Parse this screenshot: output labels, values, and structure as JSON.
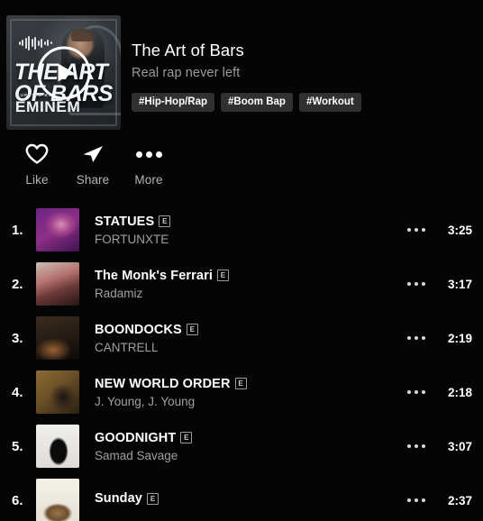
{
  "album": {
    "title": "The Art of Bars",
    "subtitle": "Real rap never left",
    "artwork": {
      "line1": "THE ART",
      "line2": "OF BARS",
      "credit_small": "CURATED BY",
      "credit_large": "EMINEM"
    },
    "tags": [
      "#Hip-Hop/Rap",
      "#Boom Bap",
      "#Workout"
    ]
  },
  "actions": [
    {
      "label": "Like",
      "icon": "heart-icon"
    },
    {
      "label": "Share",
      "icon": "paper-plane-icon"
    },
    {
      "label": "More",
      "icon": "ellipsis-icon"
    }
  ],
  "tracks": [
    {
      "index": "1.",
      "name": "STATUES",
      "explicit": "E",
      "artist": "FORTUNXTE",
      "duration": "3:25",
      "art_color": "#7a2f8c",
      "art_color2": "#c05a9a"
    },
    {
      "index": "2.",
      "name": "The Monk's Ferrari",
      "explicit": "E",
      "artist": "Radamiz",
      "duration": "3:17",
      "art_color": "#8d6a66",
      "art_color2": "#c5a79f"
    },
    {
      "index": "3.",
      "name": "BOONDOCKS",
      "explicit": "E",
      "artist": "CANTRELL",
      "duration": "2:19",
      "art_color": "#4a3524",
      "art_color2": "#8a5f38"
    },
    {
      "index": "4.",
      "name": "NEW WORLD ORDER",
      "explicit": "E",
      "artist": "J. Young, J. Young",
      "duration": "2:18",
      "art_color": "#6b4f2c",
      "art_color2": "#a8833f"
    },
    {
      "index": "5.",
      "name": "GOODNIGHT",
      "explicit": "E",
      "artist": "Samad Savage",
      "duration": "3:07",
      "art_color": "#e8e8e6",
      "art_color2": "#111111"
    },
    {
      "index": "6.",
      "name": "Sunday",
      "explicit": "E",
      "artist": "",
      "duration": "2:37",
      "art_color": "#efece4",
      "art_color2": "#8a6a48"
    }
  ],
  "theme": {
    "background": "#050505",
    "text_primary": "#ffffff",
    "text_secondary": "#a0a0a0",
    "tag_background": "#303030"
  }
}
